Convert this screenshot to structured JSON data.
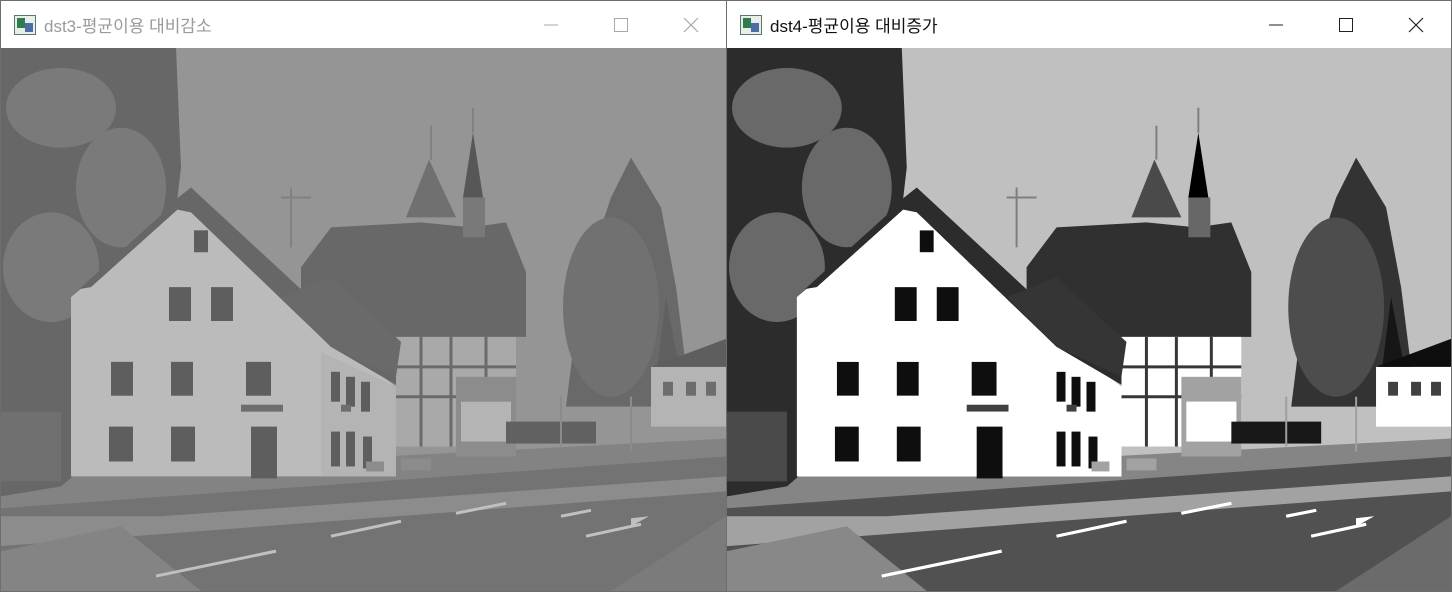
{
  "windows": [
    {
      "title": "dst3-평균이용 대비감소",
      "state": "inactive",
      "controls": [
        "minimize-icon",
        "maximize-icon",
        "close-icon"
      ]
    },
    {
      "title": "dst4-평균이용 대비증가",
      "state": "active",
      "controls": [
        "minimize-icon",
        "maximize-icon",
        "close-icon"
      ]
    }
  ],
  "image": {
    "left_adjustment": "contrast decreased",
    "right_adjustment": "contrast increased",
    "colors": {
      "sky_low": "#8d8d8d",
      "sky_high": "#ffffff",
      "frame": "#6e6e6e"
    }
  }
}
